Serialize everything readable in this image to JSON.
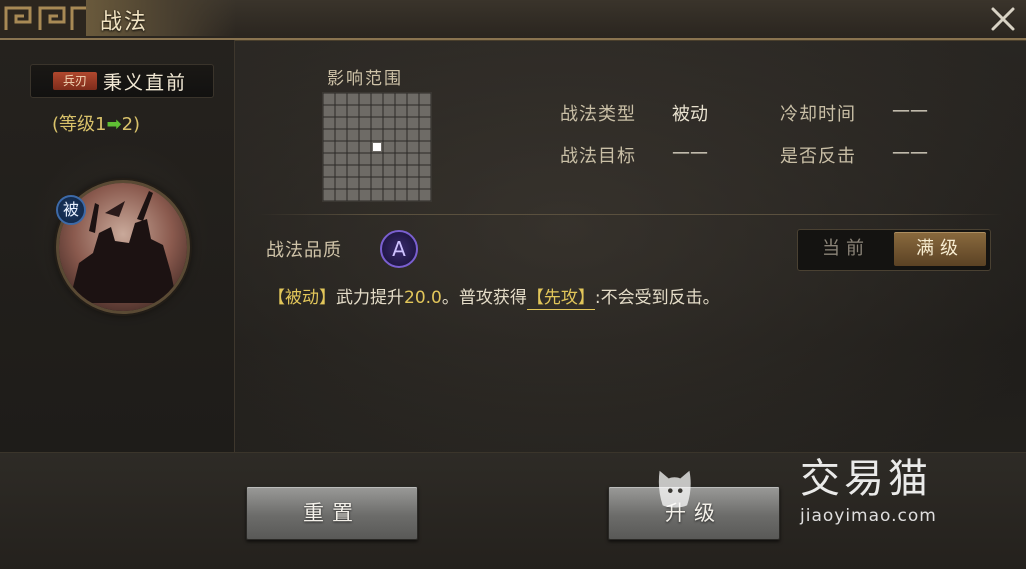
{
  "window": {
    "title": "战法"
  },
  "skill": {
    "tag": "兵刃",
    "name": "秉义直前",
    "level_text_prefix": "(等级1",
    "level_arrow": "➡",
    "level_text_suffix": "2)",
    "passive_badge": "被"
  },
  "range": {
    "label": "影响范围",
    "grid_size": 9,
    "center_cell": [
      4,
      4
    ]
  },
  "info": {
    "type_label": "战法类型",
    "type_value": "被动",
    "cooldown_label": "冷却时间",
    "cooldown_value": "——",
    "target_label": "战法目标",
    "target_value": "——",
    "counter_label": "是否反击",
    "counter_value": "——"
  },
  "quality": {
    "label": "战法品质",
    "grade": "A"
  },
  "toggle": {
    "current_label": "当前",
    "max_label": "满级",
    "selected": "满级"
  },
  "description": {
    "part1": "【被动】",
    "part2": "武力提升",
    "part3": "20.0",
    "part4": "。普攻获得",
    "part5": "【先攻】",
    "part6": ":不会受到反击。"
  },
  "buttons": {
    "reset": "重置",
    "upgrade": "升级"
  },
  "watermark": {
    "name": "交易猫",
    "url": "jiaoyimao.com"
  },
  "colors": {
    "gold_text": "#e2c65a",
    "level_green": "#5fbf34",
    "tag_red": "#b0482e",
    "quality_purple": "#7a5fd0",
    "toggle_active": "#8a6a3e"
  }
}
